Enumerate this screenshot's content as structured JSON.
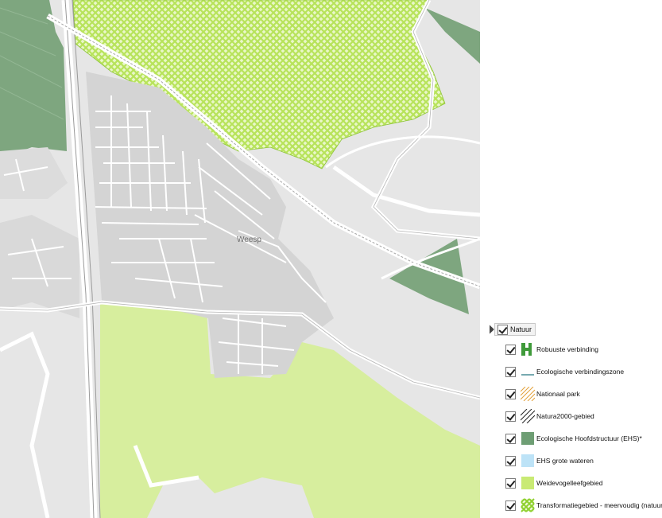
{
  "map": {
    "town_label": "Weesp",
    "colors": {
      "background": "#e7e7e7",
      "built_area": "#d4d4d4",
      "roads": "#ffffff",
      "ehs_green": "#6e9e74",
      "weidevogel": "#d7ee9e",
      "transformatie": "#b9e25a"
    }
  },
  "legend": {
    "group": {
      "label": "Natuur",
      "checked": true
    },
    "items": [
      {
        "label": "Robuuste verbinding",
        "symbol": "robuust-icon",
        "checked": true
      },
      {
        "label": "Ecologische verbindingszone",
        "symbol": "line-icon",
        "checked": true
      },
      {
        "label": "Nationaal park",
        "symbol": "orange-hatch-icon",
        "checked": true
      },
      {
        "label": "Natura2000-gebied",
        "symbol": "black-hatch-icon",
        "checked": true
      },
      {
        "label": "Ecologische Hoofdstructuur (EHS)*",
        "symbol": "green-square-icon",
        "checked": true
      },
      {
        "label": "EHS grote wateren",
        "symbol": "lightblue-square-icon",
        "checked": true
      },
      {
        "label": "Weidevogelleefgebied",
        "symbol": "lightgreen-square-icon",
        "checked": true
      },
      {
        "label": "Transformatiegebied - meervoudig (natuur)",
        "symbol": "crosshatch-green-icon",
        "checked": true
      }
    ]
  }
}
